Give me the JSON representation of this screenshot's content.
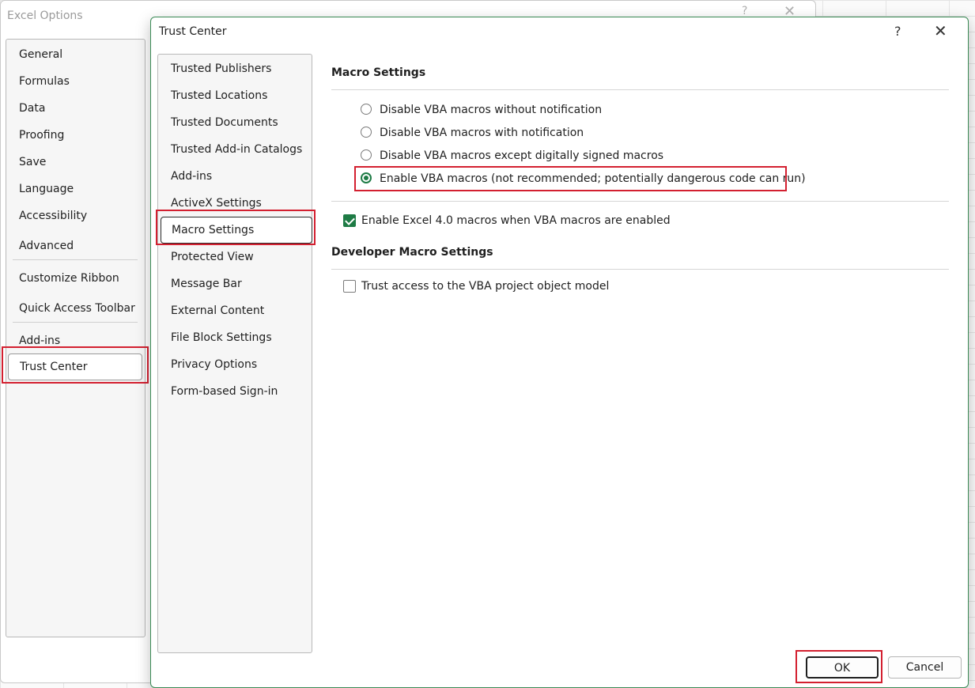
{
  "excel_options": {
    "title": "Excel Options",
    "help_glyph": "?",
    "close_glyph": "✕",
    "nav": [
      "General",
      "Formulas",
      "Data",
      "Proofing",
      "Save",
      "Language",
      "Accessibility",
      "Advanced",
      "Customize Ribbon",
      "Quick Access Toolbar",
      "Add-ins",
      "Trust Center"
    ],
    "selected": "Trust Center"
  },
  "trust_center": {
    "title": "Trust Center",
    "help_glyph": "?",
    "close_glyph": "✕",
    "nav": [
      "Trusted Publishers",
      "Trusted Locations",
      "Trusted Documents",
      "Trusted Add-in Catalogs",
      "Add-ins",
      "ActiveX Settings",
      "Macro Settings",
      "Protected View",
      "Message Bar",
      "External Content",
      "File Block Settings",
      "Privacy Options",
      "Form-based Sign-in"
    ],
    "selected": "Macro Settings",
    "macro_settings": {
      "heading": "Macro Settings",
      "options": [
        "Disable VBA macros without notification",
        "Disable VBA macros with notification",
        "Disable VBA macros except digitally signed macros",
        "Enable VBA macros (not recommended; potentially dangerous code can run)"
      ],
      "selected_option": "Enable VBA macros (not recommended; potentially dangerous code can run)",
      "excel4_checkbox": {
        "label": "Enable Excel 4.0 macros when VBA macros are enabled",
        "checked": true
      }
    },
    "developer": {
      "heading": "Developer Macro Settings",
      "vba_access_checkbox": {
        "label": "Trust access to the VBA project object model",
        "checked": false
      }
    },
    "buttons": {
      "ok": "OK",
      "cancel": "Cancel"
    }
  },
  "colors": {
    "accent_green": "#1e7b45",
    "highlight_red": "#d32030"
  }
}
